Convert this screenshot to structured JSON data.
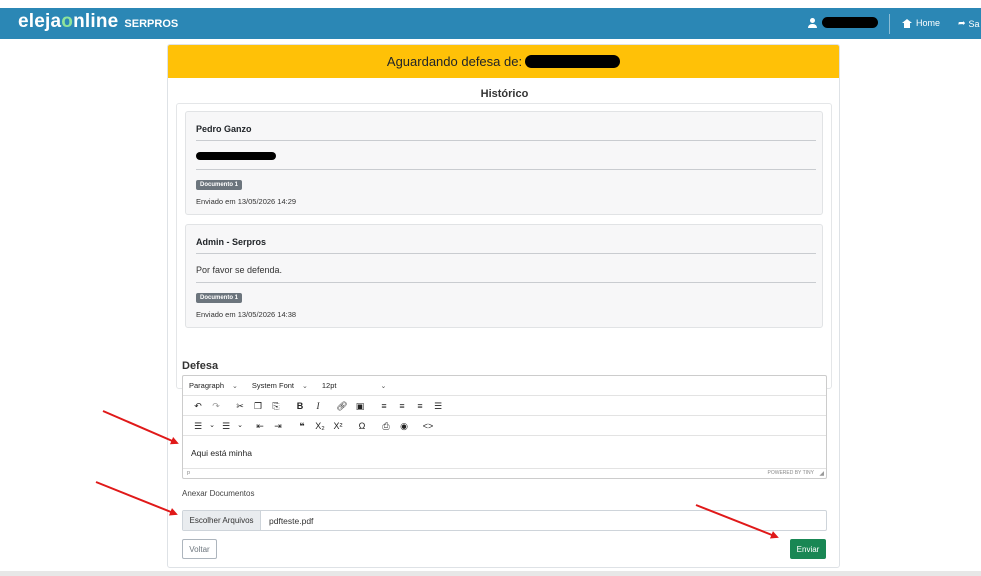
{
  "navbar": {
    "brand_prefix": "eleja",
    "brand_o": "o",
    "brand_suffix": "nline",
    "brand_sub": "SERPROS",
    "home_label": "Home",
    "exit_label": "Sa"
  },
  "header": {
    "title": "Aguardando defesa de:"
  },
  "historico": {
    "title": "Histórico",
    "messages": [
      {
        "author": "Pedro Ganzo",
        "text": "",
        "badge": "Documento 1",
        "date": "Enviado em 13/05/2026 14:29"
      },
      {
        "author": "Admin - Serpros",
        "text": "Por favor se defenda.",
        "badge": "Documento 1",
        "date": "Enviado em 13/05/2026 14:38"
      }
    ]
  },
  "defesa": {
    "label": "Defesa",
    "toolbar": {
      "block_format": "Paragraph",
      "font_family": "System Font",
      "font_size": "12pt"
    },
    "content": "Aqui está minha",
    "status_path": "p",
    "powered": "POWERED BY TINY"
  },
  "anexar": {
    "label": "Anexar Documentos",
    "button": "Escolher Arquivos",
    "filename": "pdfteste.pdf"
  },
  "actions": {
    "voltar": "Voltar",
    "enviar": "Enviar"
  },
  "colors": {
    "navbar": "#2b87b5",
    "header": "#ffc107",
    "enviar": "#198754",
    "arrow": "#e01919"
  }
}
